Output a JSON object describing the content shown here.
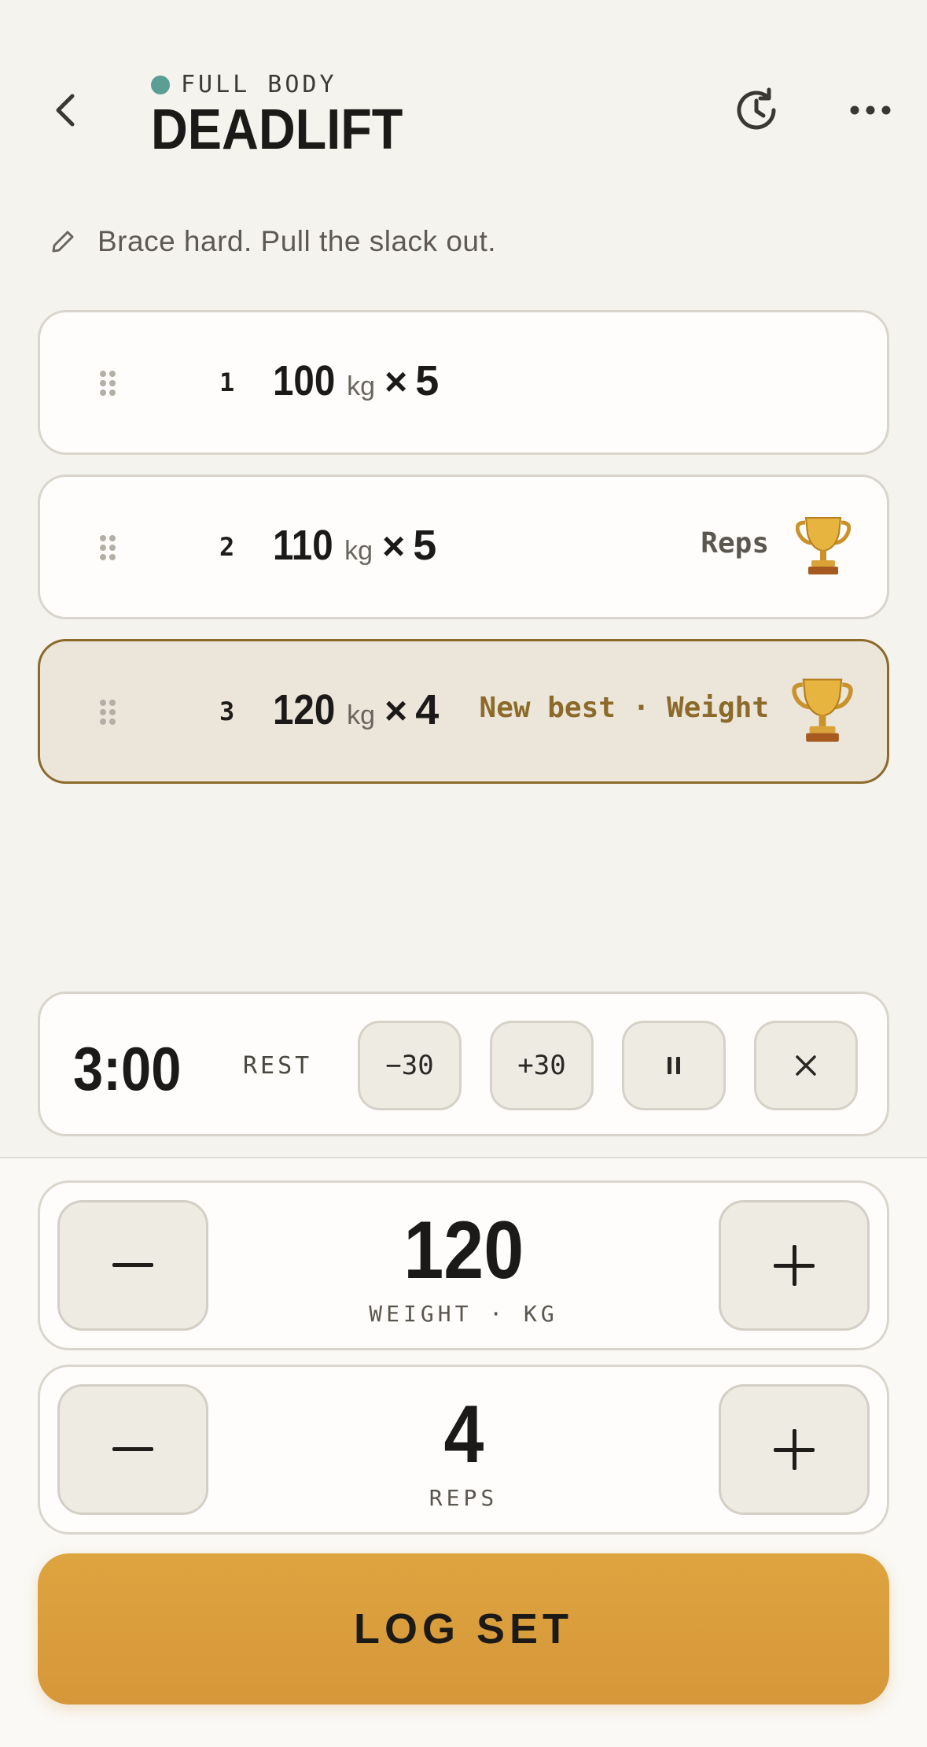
{
  "header": {
    "category": "FULL BODY",
    "category_color": "#5b9e94",
    "title": "DEADLIFT",
    "icons": [
      "chevron-left-icon",
      "history-icon",
      "more-icon"
    ]
  },
  "note": {
    "text": "Brace hard. Pull the slack out.",
    "icon": "pencil-icon"
  },
  "sets": [
    {
      "number": "1",
      "weight": "100",
      "unit": "kg",
      "times": "×",
      "reps": "5",
      "badge": "",
      "badge_color": ""
    },
    {
      "number": "2",
      "weight": "110",
      "unit": "kg",
      "times": "×",
      "reps": "5",
      "badge": "Reps",
      "badge_color": "#5a5650"
    },
    {
      "number": "3",
      "weight": "120",
      "unit": "kg",
      "times": "×",
      "reps": "4",
      "badge": "New best · Weight",
      "badge_color": "#8c6a2a"
    }
  ],
  "rest": {
    "time": "3:00",
    "label": "REST",
    "minus_label": "−30",
    "plus_label": "+30"
  },
  "weight_stepper": {
    "value": "120",
    "label": "WEIGHT · KG"
  },
  "reps_stepper": {
    "value": "4",
    "label": "REPS"
  },
  "log_button": {
    "label": "LOG SET",
    "color": "#dea43f"
  }
}
